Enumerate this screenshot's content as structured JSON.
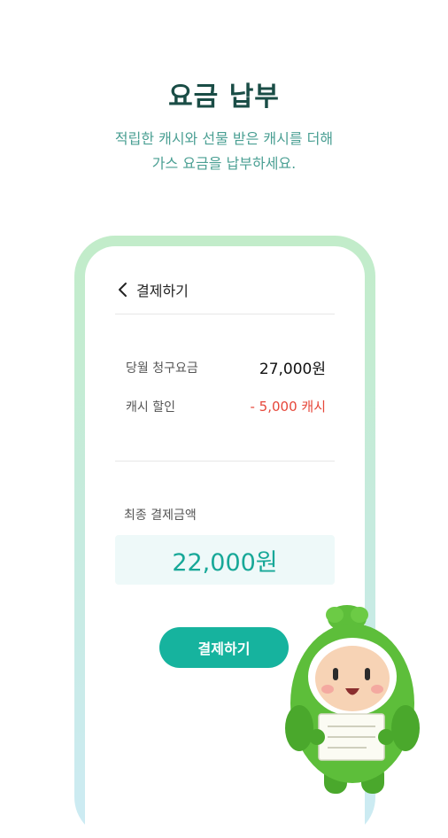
{
  "header": {
    "title": "요금 납부",
    "subtitle_line1": "적립한 캐시와 선물 받은 캐시를 더해",
    "subtitle_line2": "가스 요금을 납부하세요."
  },
  "screen": {
    "back_icon": "chevron-left-icon",
    "title": "결제하기",
    "items": [
      {
        "label": "당월 청구요금",
        "value": "27,000원"
      },
      {
        "label": "캐시 할인",
        "value": "- 5,000 캐시"
      }
    ],
    "final": {
      "label": "최종 결제금액",
      "amount": "22,000원"
    },
    "pay_button": "결제하기"
  },
  "colors": {
    "brand": "#16b39e",
    "title": "#1a4d46",
    "discount": "#e6473a",
    "amount": "#17a898",
    "mascot": "#5dbe3a"
  }
}
